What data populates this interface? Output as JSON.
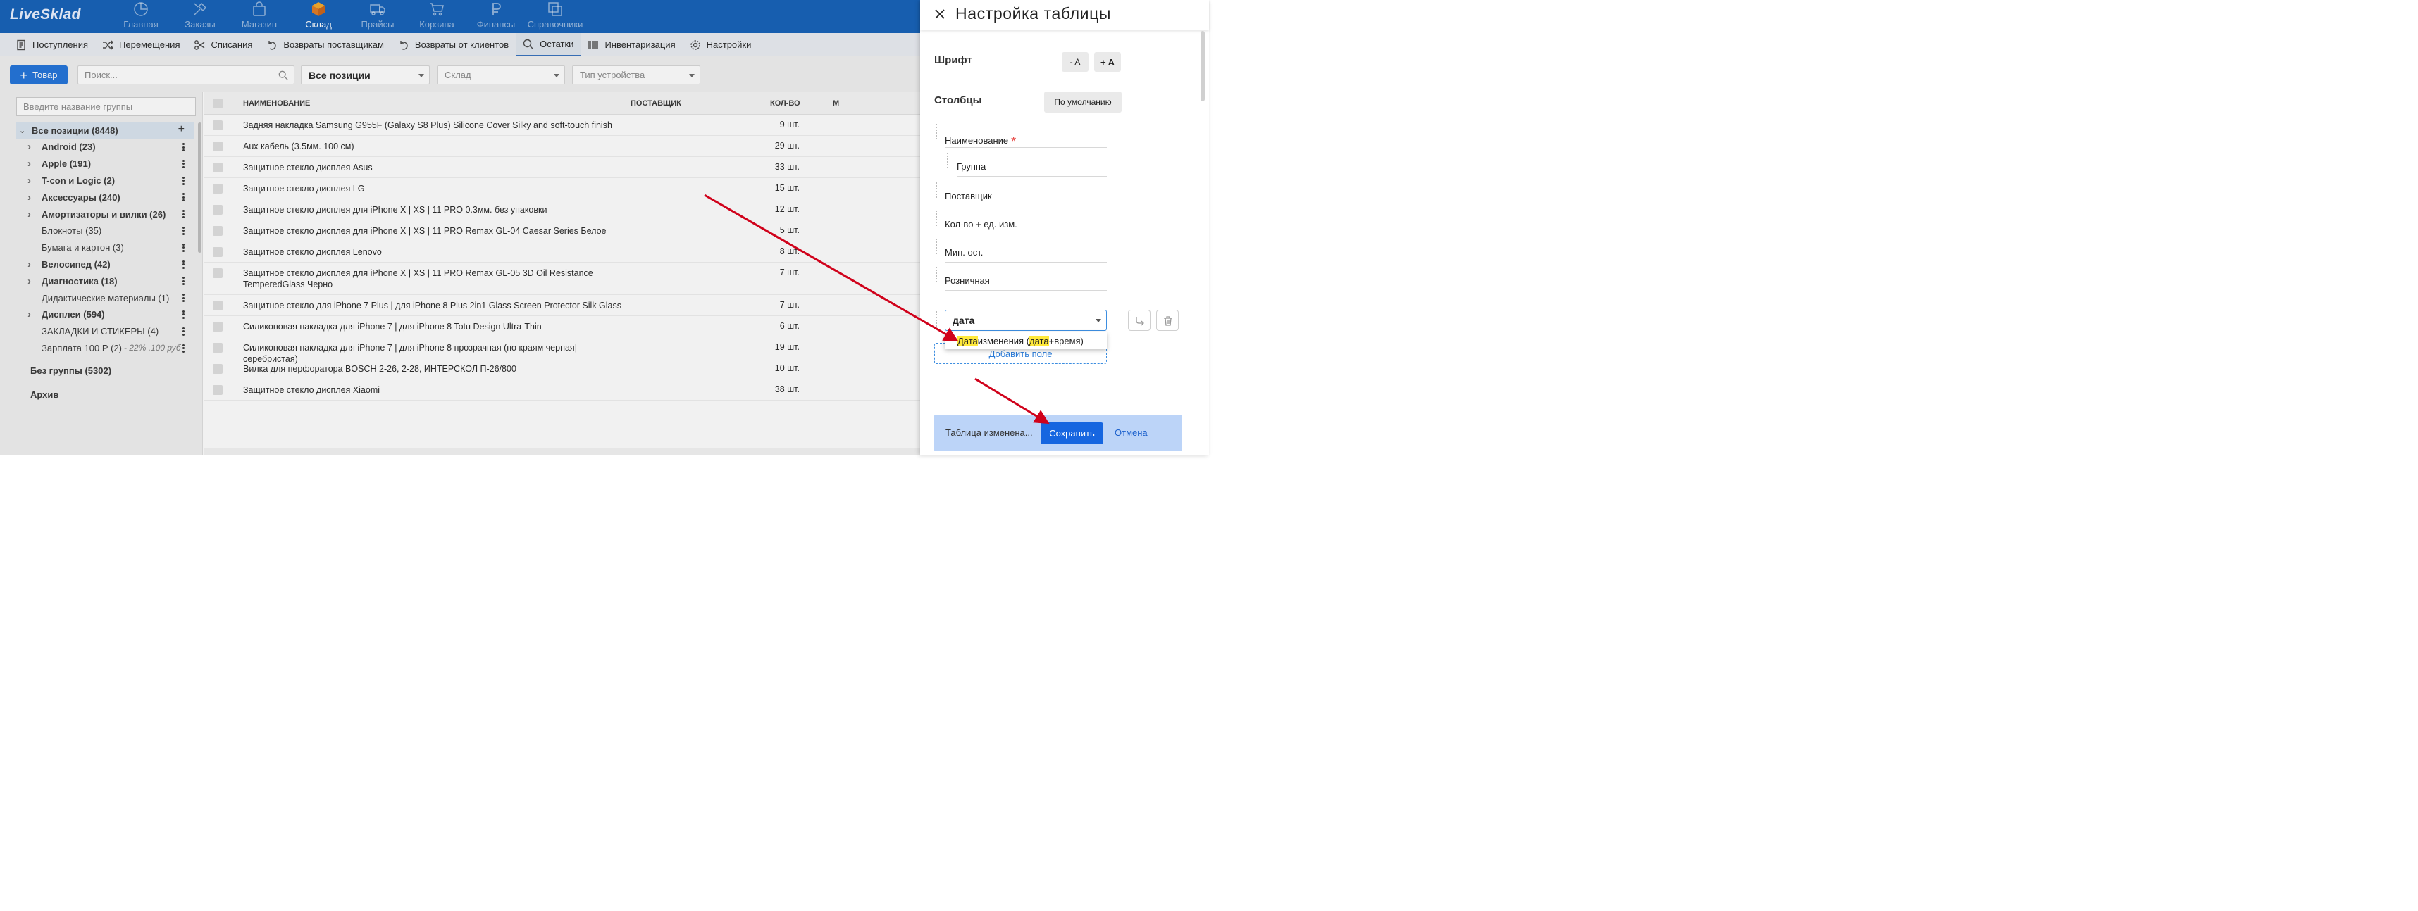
{
  "app": {
    "logo": "LiveSklad"
  },
  "topnav": [
    {
      "label": "Главная",
      "icon": "dashboard-icon",
      "active": false
    },
    {
      "label": "Заказы",
      "icon": "repair-tools-icon",
      "active": false
    },
    {
      "label": "Магазин",
      "icon": "shop-bag-icon",
      "active": false
    },
    {
      "label": "Склад",
      "icon": "warehouse-box-icon",
      "active": true
    },
    {
      "label": "Прайсы",
      "icon": "truck-icon",
      "active": false
    },
    {
      "label": "Корзина",
      "icon": "cart-icon",
      "active": false
    },
    {
      "label": "Финансы",
      "icon": "ruble-icon",
      "active": false
    },
    {
      "label": "Справочники",
      "icon": "directory-icon",
      "active": false
    }
  ],
  "subnav": [
    {
      "label": "Поступления",
      "icon": "receipt-icon",
      "active": false
    },
    {
      "label": "Перемещения",
      "icon": "shuffle-icon",
      "active": false
    },
    {
      "label": "Списания",
      "icon": "scissors-icon",
      "active": false
    },
    {
      "label": "Возвраты поставщикам",
      "icon": "return-icon",
      "active": false
    },
    {
      "label": "Возвраты от клиентов",
      "icon": "return-icon",
      "active": false
    },
    {
      "label": "Остатки",
      "icon": "search-icon",
      "active": true
    },
    {
      "label": "Инвентаризация",
      "icon": "barcode-icon",
      "active": false
    },
    {
      "label": "Настройки",
      "icon": "gear-icon",
      "active": false
    }
  ],
  "filters": {
    "add_label": "Товар",
    "search_placeholder": "Поиск...",
    "positions_value": "Все позиции",
    "warehouse_placeholder": "Склад",
    "device_placeholder": "Тип устройства"
  },
  "tree": {
    "filter_placeholder": "Введите название группы",
    "root": {
      "label": "Все позиции (8448)"
    },
    "items": [
      {
        "label": "Android (23)",
        "expandable": true,
        "bold": true,
        "extra": ""
      },
      {
        "label": "Apple (191)",
        "expandable": true,
        "bold": true,
        "extra": ""
      },
      {
        "label": "T-con и Logic (2)",
        "expandable": true,
        "bold": true,
        "extra": ""
      },
      {
        "label": "Аксессуары (240)",
        "expandable": true,
        "bold": true,
        "extra": ""
      },
      {
        "label": "Амортизаторы и вилки (26)",
        "expandable": true,
        "bold": true,
        "extra": ""
      },
      {
        "label": "Блокноты (35)",
        "expandable": false,
        "bold": false,
        "extra": ""
      },
      {
        "label": "Бумага и картон (3)",
        "expandable": false,
        "bold": false,
        "extra": ""
      },
      {
        "label": "Велосипед (42)",
        "expandable": true,
        "bold": true,
        "extra": ""
      },
      {
        "label": "Диагностика (18)",
        "expandable": true,
        "bold": true,
        "extra": ""
      },
      {
        "label": "Дидактические материалы (1)",
        "expandable": false,
        "bold": false,
        "extra": ""
      },
      {
        "label": "Дисплеи (594)",
        "expandable": true,
        "bold": true,
        "extra": ""
      },
      {
        "label": "ЗАКЛАДКИ И СТИКЕРЫ (4)",
        "expandable": false,
        "bold": false,
        "extra": ""
      },
      {
        "label": "Зарплата 100 Р (2)",
        "expandable": false,
        "bold": false,
        "extra": "- 22% ,100 руб"
      }
    ],
    "no_group": "Без группы (5302)",
    "archive": "Архив"
  },
  "table": {
    "headers": {
      "name": "НАИМЕНОВАНИЕ",
      "supplier": "ПОСТАВЩИК",
      "qty": "КОЛ-ВО",
      "cut": "М"
    },
    "rows": [
      {
        "name": "Задняя накладка Samsung G955F (Galaxy S8 Plus) Silicone Cover Silky and soft-touch finish",
        "qty": "9 шт."
      },
      {
        "name": "Aux кабель (3.5мм. 100 см)",
        "qty": "29 шт."
      },
      {
        "name": "Защитное стекло дисплея Asus",
        "qty": "33 шт."
      },
      {
        "name": "Защитное стекло дисплея LG",
        "qty": "15 шт."
      },
      {
        "name": "Защитное стекло дисплея для iPhone X | XS | 11 PRO 0.3мм. без упаковки",
        "qty": "12 шт."
      },
      {
        "name": "Защитное стекло дисплея для iPhone X | XS | 11 PRO Remax GL-04 Caesar Series Белое",
        "qty": "5 шт."
      },
      {
        "name": "Защитное стекло дисплея Lenovo",
        "qty": "8 шт."
      },
      {
        "name": "Защитное стекло дисплея для iPhone X | XS | 11 PRO Remax GL-05 3D Oil Resistance TemperedGlass Черно",
        "qty": "7 шт."
      },
      {
        "name": "Защитное стекло для iPhone 7 Plus | для iPhone 8 Plus 2in1 Glass Screen Protector Silk Glass",
        "qty": "7 шт."
      },
      {
        "name": "Силиконовая накладка для iPhone 7 | для iPhone 8 Totu Design Ultra-Thin",
        "qty": "6 шт."
      },
      {
        "name": "Силиконовая накладка для iPhone 7 | для iPhone 8 прозрачная (по краям черная|серебристая)",
        "qty": "19 шт."
      },
      {
        "name": "Вилка для перфоратора BOSCH 2-26, 2-28, ИНТЕРСКОЛ П-26/800",
        "qty": "10 шт."
      },
      {
        "name": "Защитное стекло дисплея Xiaomi",
        "qty": "38 шт."
      }
    ]
  },
  "drawer": {
    "title": "Настройка таблицы",
    "font_label": "Шрифт",
    "font_minus": "- A",
    "font_plus": "+ A",
    "columns_label": "Столбцы",
    "default_button": "По умолчанию",
    "columns": [
      {
        "label": "Наименование",
        "required": true,
        "indent": false
      },
      {
        "label": "Группа",
        "required": false,
        "indent": true
      },
      {
        "label": "Поставщик",
        "required": false,
        "indent": false
      },
      {
        "label": "Кол-во + ед. изм.",
        "required": false,
        "indent": false
      },
      {
        "label": "Мин. ост.",
        "required": false,
        "indent": false
      },
      {
        "label": "Розничная",
        "required": false,
        "indent": false
      }
    ],
    "editing_value": "дата",
    "suggestion": {
      "part1": "Дата",
      "part2": " изменения (",
      "part3": "дата",
      "part4": "+время)"
    },
    "add_field": "Добавить поле",
    "status": "Таблица изменена...",
    "save": "Сохранить",
    "cancel": "Отмена"
  },
  "colors": {
    "primary": "#0d5cb6",
    "accent": "#1666e0",
    "highlight": "#ffe93b",
    "annotation": "#d0021b"
  }
}
